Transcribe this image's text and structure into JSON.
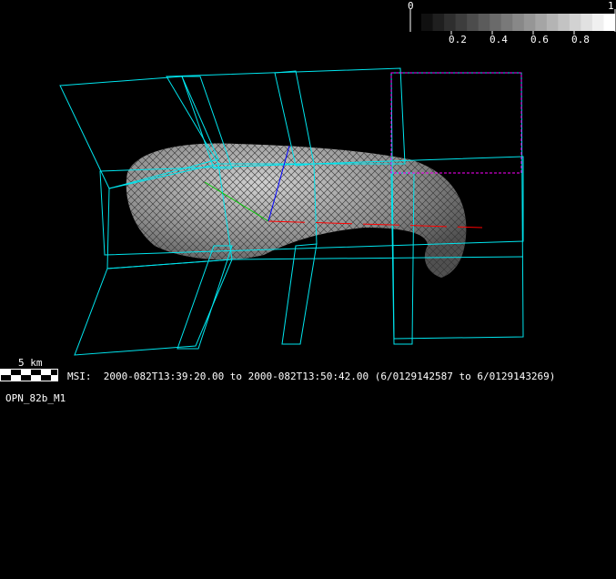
{
  "colorbar": {
    "min_label": "0",
    "max_label": "1",
    "tick_labels": [
      "0.2",
      "0.4",
      "0.6",
      "0.8"
    ],
    "steps": 17
  },
  "scale_bar": {
    "label": "5 km"
  },
  "info": {
    "instrument_line": "MSI:  2000-082T13:39:20.00 to 2000-082T13:50:42.00 (6/0129142587 to 6/0129143269)",
    "model_name": "OPN_82b_M1"
  },
  "colors": {
    "frame": "#00e5ee",
    "selection": "#ff00ff",
    "axis_x": "#ff0000",
    "axis_y": "#00cc00",
    "axis_z": "#0000ff",
    "asteroid": "#9a9a9a"
  }
}
